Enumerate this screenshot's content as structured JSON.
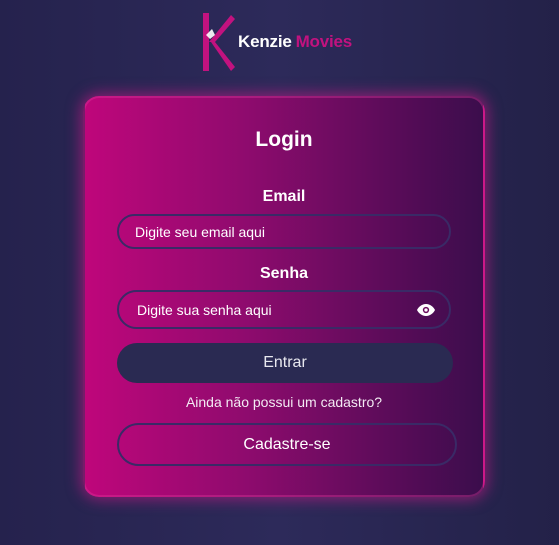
{
  "brand": {
    "name_part1": "Kenzie",
    "name_part2": "Movies",
    "logo_icon": "k-logo-icon",
    "accent_color": "#c2127f"
  },
  "login": {
    "title": "Login",
    "email_label": "Email",
    "email_placeholder": "Digite seu email aqui",
    "password_label": "Senha",
    "password_placeholder": "Digite sua senha aqui",
    "password_toggle_icon": "eye-icon",
    "submit_label": "Entrar",
    "signup_prompt": "Ainda não possui um cadastro?",
    "signup_label": "Cadastre-se"
  },
  "colors": {
    "background": "#2a2858",
    "card_gradient_start": "#bf067b",
    "card_gradient_end": "#3b0d4c",
    "button_dark": "#2a2a52"
  }
}
